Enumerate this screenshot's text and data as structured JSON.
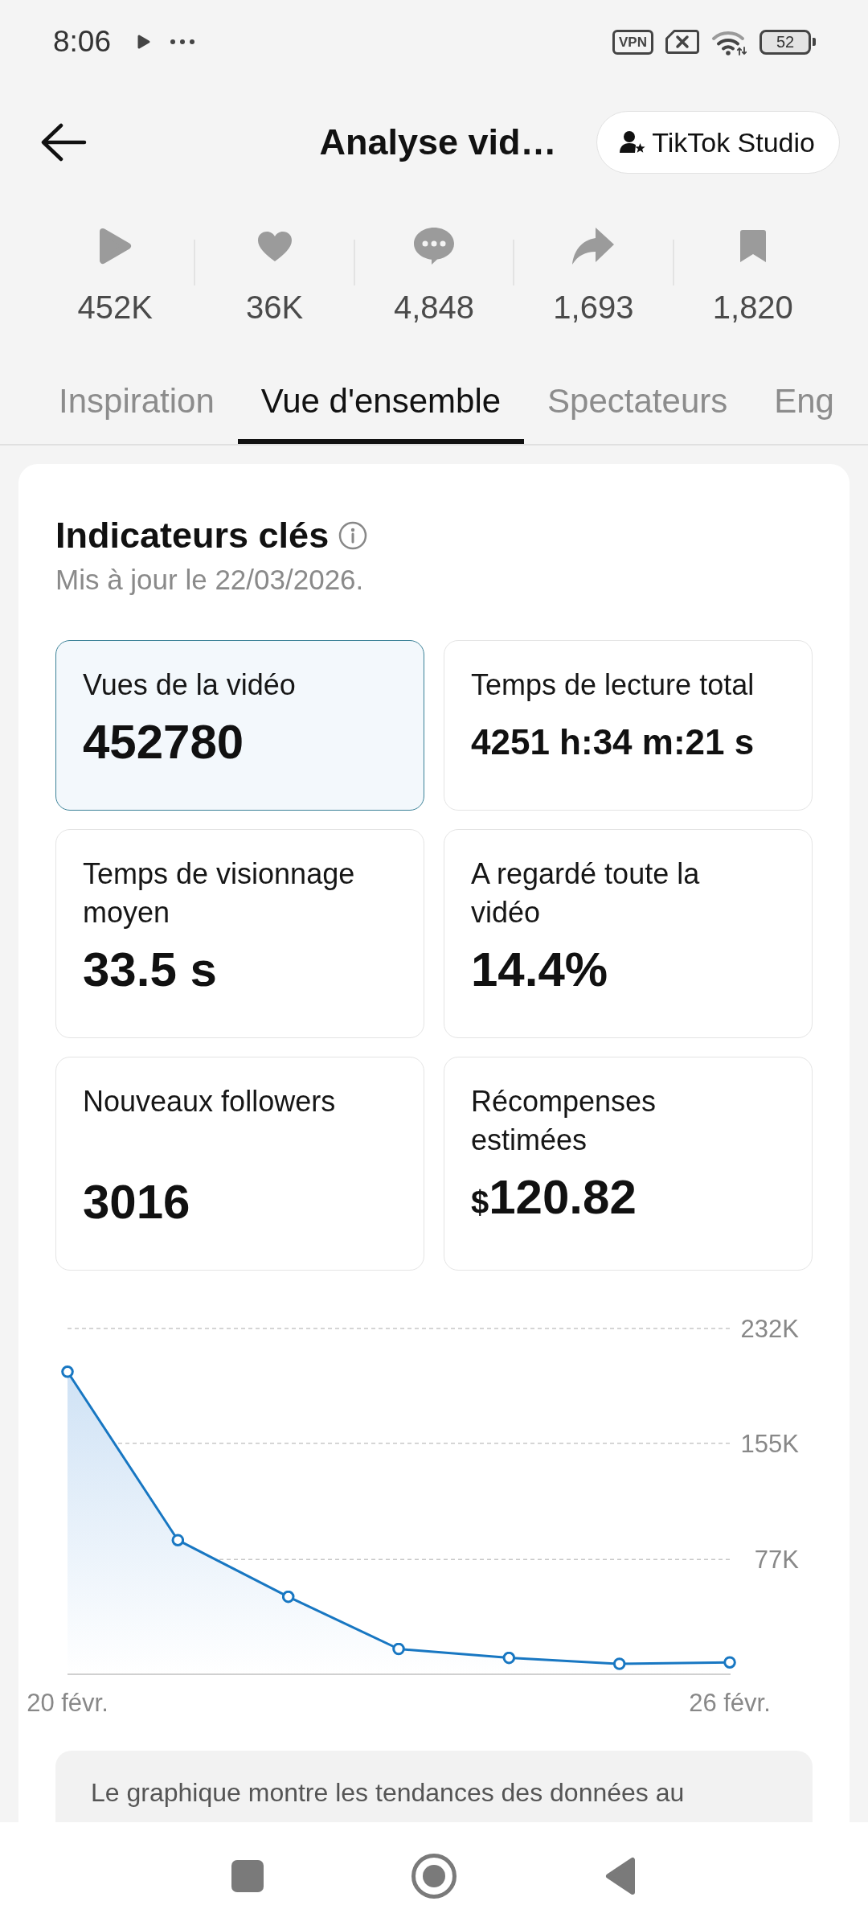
{
  "status_bar": {
    "time": "8:06",
    "vpn": "VPN",
    "battery": "52"
  },
  "header": {
    "title": "Analyse vid…",
    "studio_button": "TikTok Studio"
  },
  "stats": [
    {
      "kind": "views",
      "value": "452K"
    },
    {
      "kind": "likes",
      "value": "36K"
    },
    {
      "kind": "comments",
      "value": "4,848"
    },
    {
      "kind": "shares",
      "value": "1,693"
    },
    {
      "kind": "saves",
      "value": "1,820"
    }
  ],
  "tabs": [
    {
      "label": "Inspiration",
      "selected": false
    },
    {
      "label": "Vue d'ensemble",
      "selected": true
    },
    {
      "label": "Spectateurs",
      "selected": false
    },
    {
      "label": "Eng",
      "selected": false
    }
  ],
  "key_metrics": {
    "title": "Indicateurs clés",
    "updated": "Mis à jour le 22/03/2026.",
    "metrics": [
      {
        "label": "Vues de la vidéo",
        "value": "452780",
        "kind": "number",
        "selected": true
      },
      {
        "label": "Temps de lecture total",
        "value": "4251 h:34 m:21 s",
        "kind": "duration",
        "selected": false
      },
      {
        "label": "Temps de visionnage moyen",
        "value": "33.5 s",
        "kind": "number",
        "selected": false
      },
      {
        "label": "A regardé toute la vidéo",
        "value": "14.4%",
        "kind": "number",
        "selected": false
      },
      {
        "label": "Nouveaux followers",
        "value": "3016",
        "kind": "number",
        "selected": false
      },
      {
        "label": "Récompenses estimées",
        "prefix": "$",
        "value": "120.82",
        "kind": "number",
        "selected": false
      }
    ]
  },
  "chart": {
    "chart_data": {
      "type": "area",
      "x": [
        20,
        21,
        22,
        23,
        24,
        25,
        26
      ],
      "xlim": [
        20,
        26
      ],
      "xticks": [
        {
          "value": 20,
          "label": "20 févr."
        },
        {
          "value": 26,
          "label": "26 févr."
        }
      ],
      "values": [
        203000,
        90000,
        52000,
        17000,
        11000,
        7000,
        8000
      ],
      "yticks": [
        {
          "value": 77000,
          "label": "77K"
        },
        {
          "value": 155000,
          "label": "155K"
        },
        {
          "value": 232000,
          "label": "232K"
        }
      ],
      "ylim": [
        0,
        232000
      ]
    },
    "note": "Le graphique montre les tendances des données au"
  }
}
